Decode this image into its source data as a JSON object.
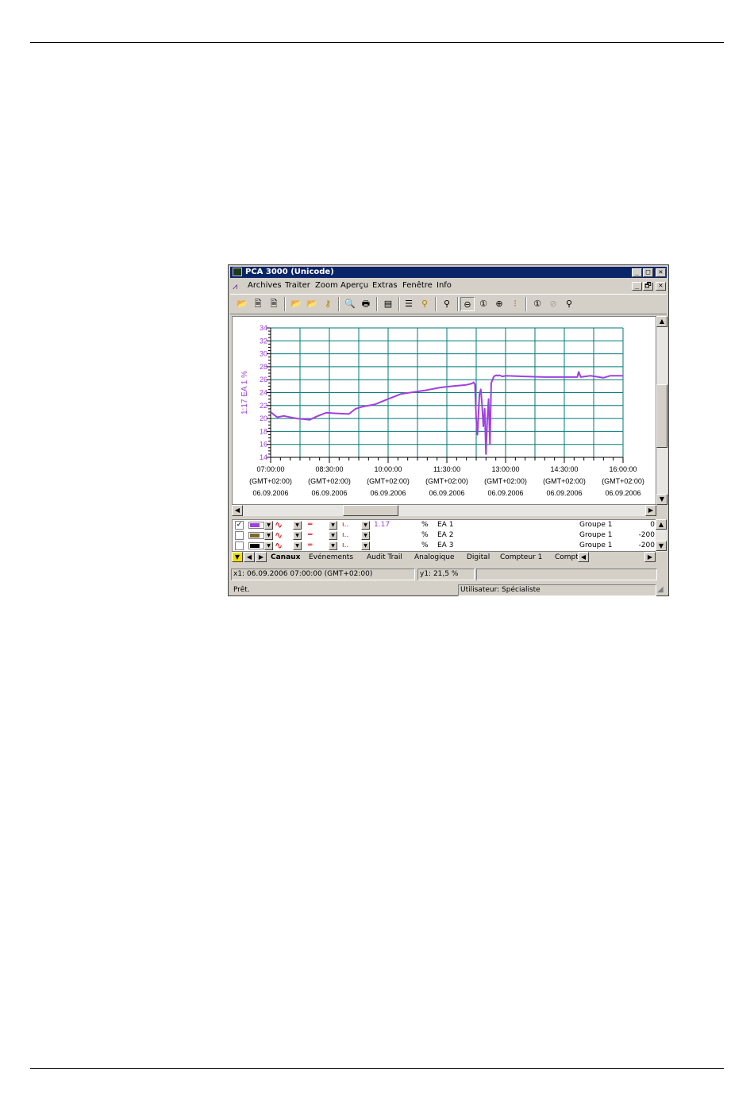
{
  "window": {
    "title": "PCA 3000 (Unicode)",
    "controls": {
      "minimize": "_",
      "maximize": "□",
      "close": "✕",
      "restore": "🗗"
    }
  },
  "menu": [
    "Archives",
    "Traiter",
    "Zoom",
    "Aperçu",
    "Extras",
    "Fenêtre",
    "Info"
  ],
  "toolbar": {
    "buttons": [
      {
        "name": "open-folder-icon",
        "glyph": "📂"
      },
      {
        "name": "save-icon",
        "glyph": "🗎"
      },
      {
        "name": "save-as-icon",
        "glyph": "🗎"
      },
      {
        "name": "import-folder-icon",
        "glyph": "📂"
      },
      {
        "name": "export-folder-icon",
        "glyph": "📂"
      },
      {
        "name": "key-icon",
        "glyph": "⚷"
      },
      {
        "name": "print-preview-icon",
        "glyph": "🔍"
      },
      {
        "name": "print-icon",
        "glyph": "🖶"
      },
      {
        "name": "properties-icon",
        "glyph": "▤"
      },
      {
        "name": "list-icon",
        "glyph": "☰"
      },
      {
        "name": "filter-icon",
        "glyph": "⚲"
      },
      {
        "name": "search-icon",
        "glyph": "⚲"
      },
      {
        "name": "zoom-out-icon",
        "glyph": "⊖"
      },
      {
        "name": "zoom-1-icon",
        "glyph": "①"
      },
      {
        "name": "zoom-in-icon",
        "glyph": "⊕"
      },
      {
        "name": "cursor-line-icon",
        "glyph": "⫶"
      },
      {
        "name": "zoom-reset-icon",
        "glyph": "①"
      },
      {
        "name": "zoom-disabled-icon",
        "glyph": "⊘"
      },
      {
        "name": "zoom-back-icon",
        "glyph": "⚲"
      }
    ]
  },
  "chart_data": {
    "type": "line",
    "ylabel": "1:17 EA 1 %",
    "ylim": [
      14,
      34
    ],
    "yticks": [
      34,
      32,
      30,
      28,
      26,
      24,
      22,
      20,
      18,
      16,
      14
    ],
    "xlim": [
      "07:00:00",
      "16:00:00"
    ],
    "xticks": [
      {
        "time": "07:00:00",
        "tz": "(GMT+02:00)",
        "date": "06.09.2006"
      },
      {
        "time": "08:30:00",
        "tz": "(GMT+02:00)",
        "date": "06.09.2006"
      },
      {
        "time": "10:00:00",
        "tz": "(GMT+02:00)",
        "date": "06.09.2006"
      },
      {
        "time": "11:30:00",
        "tz": "(GMT+02:00)",
        "date": "06.09.2006"
      },
      {
        "time": "13:00:00",
        "tz": "(GMT+02:00)",
        "date": "06.09.2006"
      },
      {
        "time": "14:30:00",
        "tz": "(GMT+02:00)",
        "date": "06.09.2006"
      },
      {
        "time": "16:00:00",
        "tz": "(GMT+02:00)",
        "date": "06.09.2006"
      }
    ],
    "grid": true,
    "color": "#a040e0",
    "series": [
      {
        "x": [
          "07:00",
          "07:10",
          "07:20",
          "07:40",
          "08:00",
          "08:10",
          "08:25",
          "08:40",
          "09:00",
          "09:10",
          "09:20",
          "09:40",
          "10:00",
          "10:20",
          "10:40",
          "11:00",
          "11:20",
          "11:40",
          "12:00",
          "12:08",
          "12:10",
          "12:11",
          "12:13",
          "12:15",
          "12:17",
          "12:20",
          "12:22",
          "12:24",
          "12:26",
          "12:28",
          "12:30",
          "12:32",
          "12:34",
          "12:36",
          "12:38",
          "12:40",
          "12:42",
          "12:44",
          "12:46",
          "12:48",
          "12:50",
          "12:55",
          "13:00",
          "13:30",
          "14:00",
          "14:30",
          "14:50",
          "14:52",
          "14:55",
          "15:10",
          "15:30",
          "15:40",
          "16:00"
        ],
        "y": [
          21.0,
          20.2,
          20.4,
          20.0,
          19.8,
          20.3,
          20.9,
          20.8,
          20.7,
          21.5,
          21.8,
          22.2,
          23.0,
          23.8,
          24.1,
          24.4,
          24.8,
          25.0,
          25.2,
          25.4,
          25.5,
          25.6,
          25.3,
          20.0,
          17.5,
          23.8,
          24.5,
          22.0,
          18.8,
          21.5,
          14.5,
          20.0,
          23.0,
          16.0,
          25.5,
          26.0,
          26.5,
          26.6,
          26.7,
          26.6,
          26.7,
          26.5,
          26.6,
          26.5,
          26.4,
          26.4,
          26.4,
          27.2,
          26.4,
          26.6,
          26.3,
          26.6,
          26.6
        ]
      }
    ]
  },
  "channels": {
    "rows": [
      {
        "checked": true,
        "color": "#a040e0",
        "value": "1.17",
        "unit": "%",
        "name": "EA 1",
        "group": "Groupe 1",
        "offset": "0"
      },
      {
        "checked": false,
        "color": "#7a6a2a",
        "value": "",
        "unit": "%",
        "name": "EA 2",
        "group": "Groupe 1",
        "offset": "-200"
      },
      {
        "checked": false,
        "color": "#000000",
        "value": "",
        "unit": "%",
        "name": "EA 3",
        "group": "Groupe 1",
        "offset": "-200"
      }
    ],
    "check_glyph": "✓",
    "dd_glyph": "▼",
    "wave_glyph": "∿",
    "line_glyph": "═",
    "marker_glyph": "ı.."
  },
  "tabs": {
    "nav": {
      "down": "▼",
      "left": "◀",
      "right": "▶"
    },
    "items": [
      "Canaux",
      "Evénements",
      "Audit Trail",
      "Analogique",
      "Digital",
      "Compteur 1",
      "Compt"
    ],
    "active": 0
  },
  "coords": {
    "x1": "x1: 06.09.2006 07:00:00 (GMT+02:00)",
    "y1": "y1: 21,5 %"
  },
  "status": {
    "left": "Prêt.",
    "user": "Utilisateur: Spécialiste"
  },
  "scroll": {
    "up": "▲",
    "down": "▼",
    "left": "◀",
    "right": "▶"
  }
}
